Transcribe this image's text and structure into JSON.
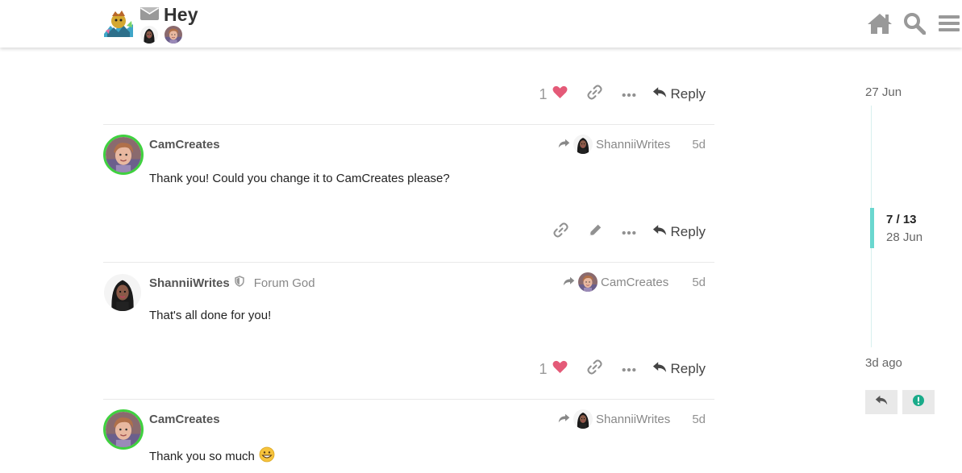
{
  "header": {
    "topic_title": "Hey",
    "icons": [
      "home-icon",
      "search-icon",
      "hamburger-menu-icon"
    ]
  },
  "posts": [
    {
      "partial": true,
      "like_count": "1",
      "reply_label": "Reply"
    },
    {
      "author": "CamCreates",
      "reply_to": "ShanniiWrites",
      "date": "5d",
      "body": "Thank you! Could you change it to CamCreates please?",
      "reply_label": "Reply"
    },
    {
      "author": "ShanniiWrites",
      "title": "Forum God",
      "reply_to": "CamCreates",
      "date": "5d",
      "body": "That's all done for you!",
      "like_count": "1",
      "reply_label": "Reply"
    },
    {
      "author": "CamCreates",
      "reply_to": "ShanniiWrites",
      "date": "5d",
      "body": "Thank you so much"
    }
  ],
  "timeline": {
    "start_date": "27 Jun",
    "position": "7 / 13",
    "position_date": "28 Jun",
    "end_date": "3d ago"
  },
  "colors": {
    "accent": "#6ad7cf",
    "like": "#e45a78",
    "online_ring": "#3fd13f",
    "notification": "#1aab8a"
  }
}
